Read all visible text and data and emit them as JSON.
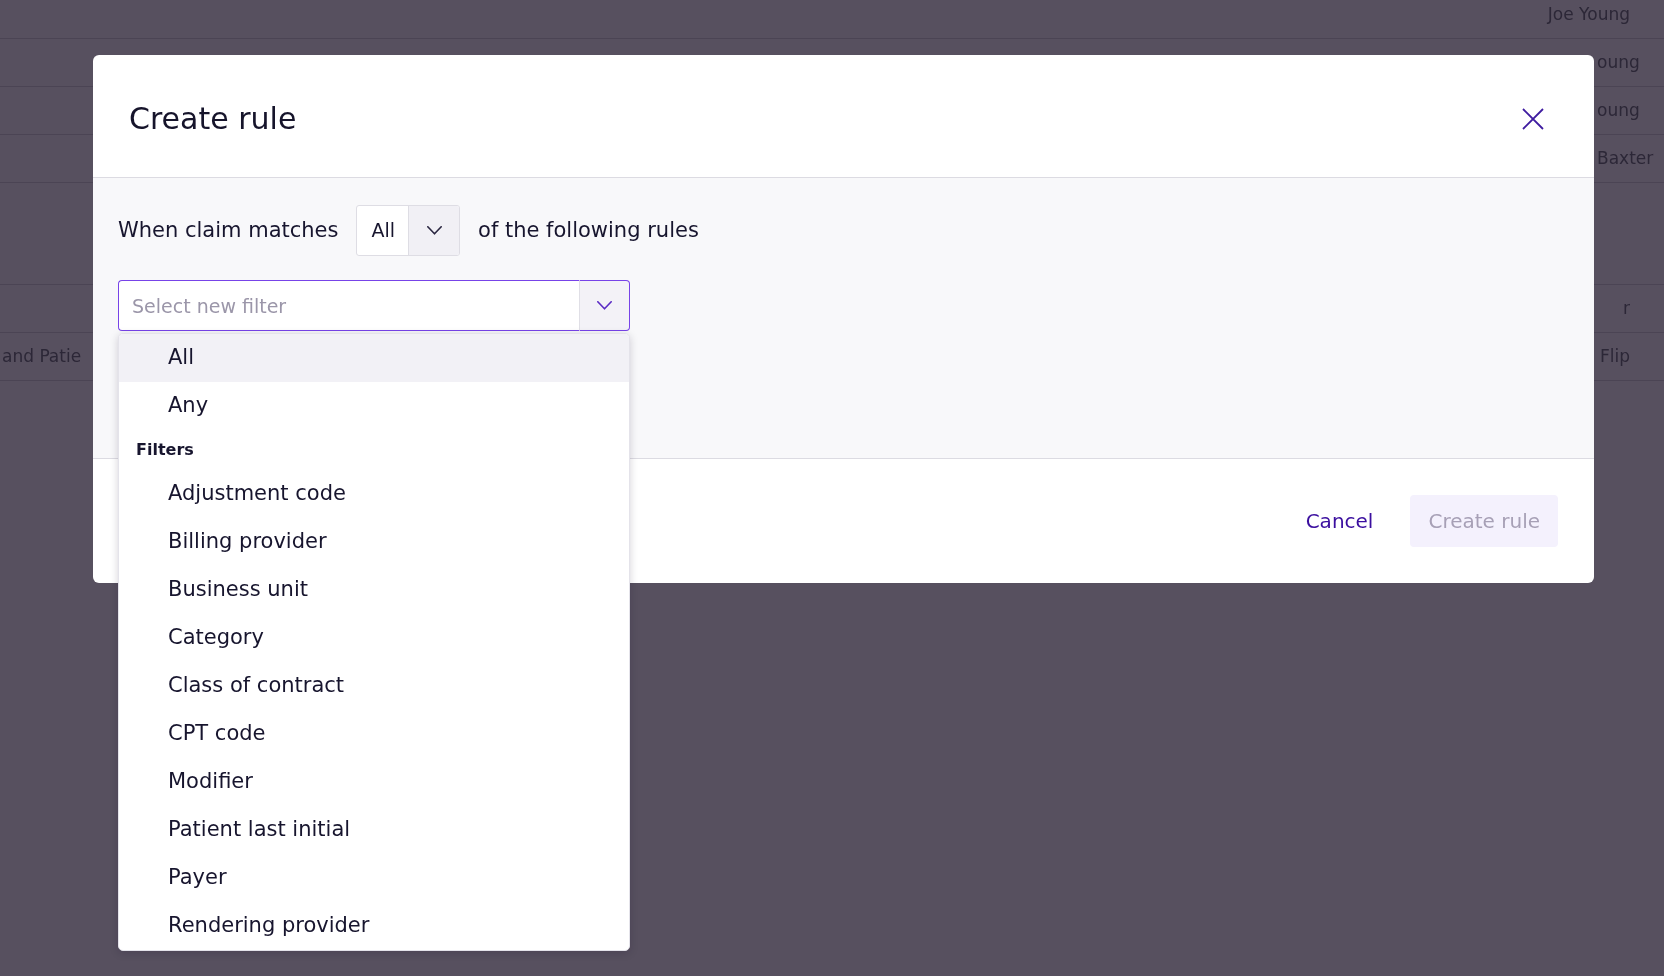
{
  "background_table": {
    "groups": [
      {
        "rows": [
          {
            "column_2": "Joe Young"
          },
          {
            "column_2": "oung"
          },
          {
            "column_2": "oung"
          },
          {
            "column_2": "Baxter"
          }
        ]
      },
      {
        "rows": [
          {
            "column_2": "r"
          },
          {
            "column_1": "and Patie",
            "column_2": "Flip"
          }
        ]
      }
    ]
  },
  "dialog": {
    "title": "Create rule",
    "match_row": {
      "prefix": "When claim matches",
      "select": {
        "value": "All"
      },
      "suffix": "of the following rules"
    },
    "filter_select": {
      "placeholder": "Select new filter",
      "expanded": true,
      "options": [
        {
          "label": "All",
          "selected": true
        },
        {
          "label": "Any",
          "selected": false
        }
      ],
      "groups": [
        {
          "heading": "Filters",
          "options": [
            {
              "label": "Adjustment code",
              "selected": false
            },
            {
              "label": "Billing provider",
              "selected": false
            },
            {
              "label": "Business unit",
              "selected": false
            },
            {
              "label": "Category",
              "selected": false
            },
            {
              "label": "Class of contract",
              "selected": false
            },
            {
              "label": "CPT code",
              "selected": false
            },
            {
              "label": "Modifier",
              "selected": false
            },
            {
              "label": "Patient last initial",
              "selected": false
            },
            {
              "label": "Payer",
              "selected": false
            },
            {
              "label": "Rendering provider",
              "selected": false
            }
          ]
        }
      ]
    },
    "footer": {
      "buttons": [
        {
          "label": "Cancel",
          "kind": "link",
          "disabled": false
        },
        {
          "label": "Create rule",
          "kind": "primary",
          "disabled": true
        }
      ]
    }
  }
}
